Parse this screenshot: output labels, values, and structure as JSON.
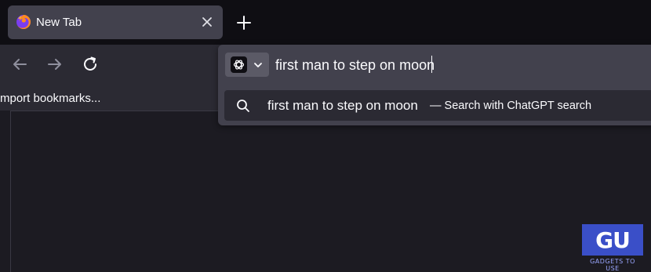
{
  "tab": {
    "title": "New Tab",
    "favicon": "firefox-icon",
    "close_icon": "close-icon"
  },
  "tabstrip": {
    "new_tab_icon": "plus-icon"
  },
  "toolbar": {
    "back_icon": "arrow-left-icon",
    "forward_icon": "arrow-right-icon",
    "reload_icon": "reload-icon"
  },
  "bookmarks": {
    "item_label": "mport bookmarks..."
  },
  "urlbar": {
    "engine_icon": "chatgpt-icon",
    "chevron_icon": "chevron-down-icon",
    "value": "first man to step on moon"
  },
  "suggestion": {
    "icon": "search-icon",
    "text": "first man to step on moon",
    "action": "— Search with ChatGPT search"
  },
  "watermark": {
    "logo": "GU",
    "text": "GADGETS TO USE"
  },
  "colors": {
    "accent": "#3a4fc8",
    "panel": "#42414d",
    "toolbar": "#2b2a33",
    "page": "#1c1b22"
  }
}
